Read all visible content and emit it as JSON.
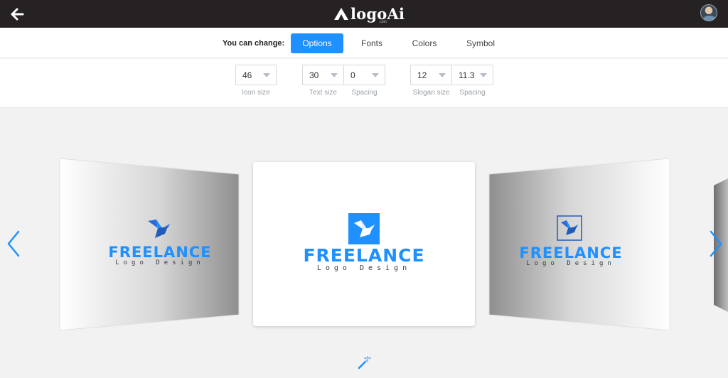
{
  "header": {
    "logo_text": "logoAi",
    "logo_sub": ".com",
    "icons": {
      "back": "back-arrow-icon",
      "avatar": "user-avatar"
    }
  },
  "tabs": {
    "label": "You can change:",
    "items": [
      {
        "label": "Options",
        "active": true
      },
      {
        "label": "Fonts",
        "active": false
      },
      {
        "label": "Colors",
        "active": false
      },
      {
        "label": "Symbol",
        "active": false
      }
    ]
  },
  "options": {
    "icon_size": {
      "value": "46",
      "label": "Icon size"
    },
    "text_size": {
      "value": "30",
      "label": "Text size"
    },
    "text_spacing": {
      "value": "0",
      "label": "Spacing"
    },
    "slogan_size": {
      "value": "12",
      "label": "Slogan size"
    },
    "slogan_spacing": {
      "value": "11.3",
      "label": "Spacing"
    }
  },
  "carousel": {
    "cards": [
      {
        "brand": "FREELANCE",
        "tagline": "Logo Design",
        "variant": "plain-icon"
      },
      {
        "brand": "FREELANCE",
        "tagline": "Logo Design",
        "variant": "filled-square-icon"
      },
      {
        "brand": "FREELANCE",
        "tagline": "Logo Design",
        "variant": "outlined-square-icon"
      }
    ],
    "icons": {
      "prev": "chevron-left-icon",
      "next": "chevron-right-icon",
      "magic": "magic-wand-icon"
    }
  },
  "colors": {
    "accent": "#1e90ff",
    "header_bg": "#262223",
    "stage_bg": "#f2f2f2"
  }
}
